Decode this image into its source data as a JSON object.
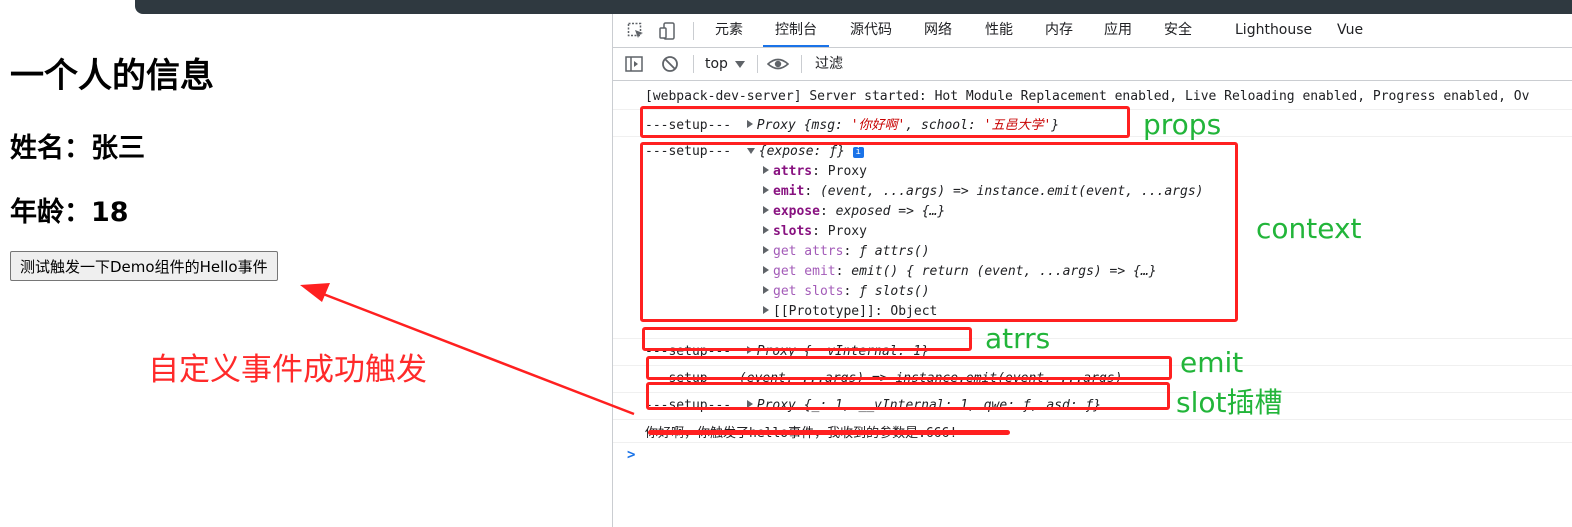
{
  "page": {
    "title": "一个人的信息",
    "name_line": "姓名：张三",
    "age_line": "年龄：18",
    "button_label": "测试触发一下Demo组件的Hello事件",
    "annotation": "自定义事件成功触发"
  },
  "devtools": {
    "tabs": [
      "元素",
      "控制台",
      "源代码",
      "网络",
      "性能",
      "内存",
      "应用",
      "安全",
      "Lighthouse",
      "Vue"
    ],
    "active_tab": "控制台",
    "context": "top",
    "filter_placeholder": "过滤",
    "icons": [
      "inspect-icon",
      "device-toggle-icon",
      "sidebar-toggle-icon",
      "clear-console-icon",
      "eye-icon"
    ],
    "colors": {
      "active_tab_underline": "#1a73e8",
      "annotation_box": "#ff2020",
      "annotation_label": "#22b53a"
    }
  },
  "console": {
    "line0": "[webpack-dev-server] Server started: Hot Module Replacement enabled, Live Reloading enabled, Progress enabled, Ov",
    "setup_prefix": "---setup---",
    "props": {
      "proxy": "Proxy",
      "open": "{",
      "k1": "msg",
      "v1": "'你好啊'",
      "k2": "school",
      "v2": "'五邑大学'",
      "close": "}"
    },
    "context": {
      "summary": "{expose: ƒ}",
      "info": "i",
      "props": [
        {
          "key": "attrs",
          "value": "Proxy",
          "style": "key"
        },
        {
          "key": "emit",
          "value": "(event, ...args) => instance.emit(event, ...args)",
          "style": "key"
        },
        {
          "key": "expose",
          "value": "exposed => {…}",
          "style": "key"
        },
        {
          "key": "slots",
          "value": "Proxy",
          "style": "key"
        },
        {
          "key": "get attrs",
          "value": "ƒ attrs()",
          "style": "gkey"
        },
        {
          "key": "get emit",
          "value": "emit() { return (event, ...args) => {…}",
          "style": "gkey"
        },
        {
          "key": "get slots",
          "value": "ƒ slots()",
          "style": "gkey"
        },
        {
          "key": "[[Prototype]]",
          "value": "Object",
          "style": "plain"
        }
      ]
    },
    "attrs": {
      "proxy": "Proxy",
      "body": "{__vInternal: 1}"
    },
    "emit": "(event, ...args) => instance.emit(event, ...args)",
    "slots": {
      "proxy": "Proxy",
      "body": "{_: 1, __vInternal: 1, qwe: ƒ, asd: ƒ}"
    },
    "hello_output": "你好啊，你触发了hello事件，我收到的参数是:666!",
    "prompt": ">"
  },
  "annotations": {
    "props": "props",
    "context": "context",
    "attrs": "atrrs",
    "emit": "emit",
    "slots": "slot插槽"
  }
}
